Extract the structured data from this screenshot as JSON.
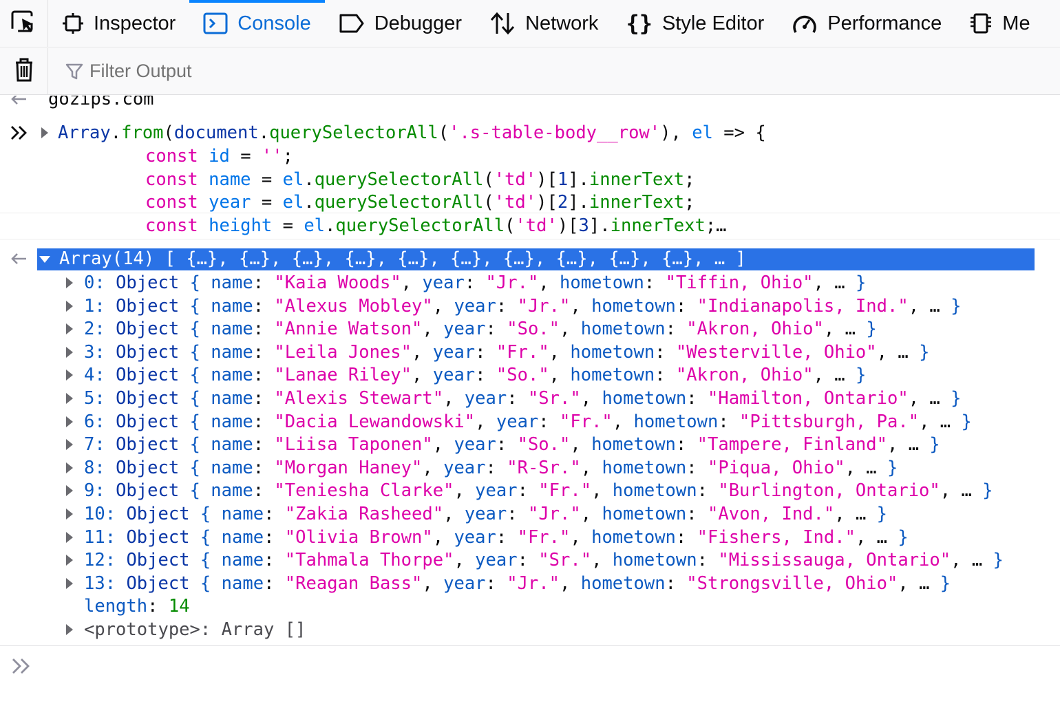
{
  "toolbar": {
    "picker_icon": "element-picker-icon",
    "tabs": [
      {
        "label": "Inspector",
        "icon": "inspector-icon"
      },
      {
        "label": "Console",
        "icon": "console-icon",
        "active": true
      },
      {
        "label": "Debugger",
        "icon": "debugger-icon"
      },
      {
        "label": "Network",
        "icon": "network-icon"
      },
      {
        "label": "Style Editor",
        "icon": "style-editor-icon"
      },
      {
        "label": "Performance",
        "icon": "performance-icon"
      },
      {
        "label": "Me",
        "icon": "memory-icon"
      }
    ],
    "accent": "#0a84ff"
  },
  "filter_bar": {
    "trash_icon": "trash-icon",
    "placeholder": "Filter Output"
  },
  "console": {
    "previous_result": "gozips.com",
    "input_lines": [
      "Array.from(document.querySelectorAll('.s-table-body__row'), el => {",
      "const id = '';",
      "const name = el.querySelectorAll('td')[1].innerText;",
      "const year = el.querySelectorAll('td')[2].innerText;",
      "const height = el.querySelectorAll('td')[3].innerText;…"
    ],
    "result_header": "Array(14) [ {…}, {…}, {…}, {…}, {…}, {…}, {…}, {…}, {…}, {…}, … ]",
    "items": [
      {
        "index": "0",
        "name": "Kaia Woods",
        "year": "Jr.",
        "hometown": "Tiffin, Ohio"
      },
      {
        "index": "1",
        "name": "Alexus Mobley",
        "year": "Jr.",
        "hometown": "Indianapolis, Ind."
      },
      {
        "index": "2",
        "name": "Annie Watson",
        "year": "So.",
        "hometown": "Akron, Ohio"
      },
      {
        "index": "3",
        "name": "Leila Jones",
        "year": "Fr.",
        "hometown": "Westerville, Ohio"
      },
      {
        "index": "4",
        "name": "Lanae Riley",
        "year": "So.",
        "hometown": "Akron, Ohio"
      },
      {
        "index": "5",
        "name": "Alexis Stewart",
        "year": "Sr.",
        "hometown": "Hamilton, Ontario"
      },
      {
        "index": "6",
        "name": "Dacia Lewandowski",
        "year": "Fr.",
        "hometown": "Pittsburgh, Pa."
      },
      {
        "index": "7",
        "name": "Liisa Taponen",
        "year": "So.",
        "hometown": "Tampere, Finland"
      },
      {
        "index": "8",
        "name": "Morgan Haney",
        "year": "R-Sr.",
        "hometown": "Piqua, Ohio"
      },
      {
        "index": "9",
        "name": "Teniesha Clarke",
        "year": "Fr.",
        "hometown": "Burlington, Ontario"
      },
      {
        "index": "10",
        "name": "Zakia Rasheed",
        "year": "Jr.",
        "hometown": "Avon, Ind."
      },
      {
        "index": "11",
        "name": "Olivia Brown",
        "year": "Fr.",
        "hometown": "Fishers, Ind."
      },
      {
        "index": "12",
        "name": "Tahmala Thorpe",
        "year": "Sr.",
        "hometown": "Mississauga, Ontario"
      },
      {
        "index": "13",
        "name": "Reagan Bass",
        "year": "Jr.",
        "hometown": "Strongsville, Ohio"
      }
    ],
    "length_label": "length",
    "length_value": "14",
    "prototype_text": "<prototype>: Array []",
    "input_value": ""
  }
}
